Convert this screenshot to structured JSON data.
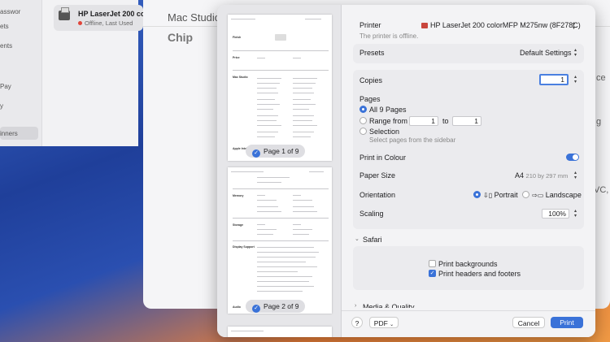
{
  "settings": {
    "sidebar_items": [
      "asswor",
      "ets",
      "ents",
      "Pay",
      "y",
      "inners"
    ],
    "selected_item": "inners",
    "printer_name": "HP LaserJet 200 color",
    "printer_status": "Offline, Last Used"
  },
  "background_window": {
    "title": "Mac Studio",
    "subtitle": "Chip",
    "right_edge_text": [
      "ce",
      "g",
      "VC,"
    ]
  },
  "preview": {
    "page1_badge": "Page 1 of 9",
    "page2_badge": "Page 2 of 9",
    "page1_labels": [
      "Finish",
      "Price",
      "Mac Studio",
      "Apple Intelligence"
    ],
    "page2_labels": [
      "Memory",
      "Storage",
      "Display Support",
      "Audio"
    ]
  },
  "dialog": {
    "printer_label": "Printer",
    "printer_value": "HP LaserJet 200 colorMFP M275nw (8F278C)",
    "printer_offline": "The printer is offline.",
    "presets_label": "Presets",
    "presets_value": "Default Settings",
    "copies_label": "Copies",
    "copies_value": "1",
    "pages_label": "Pages",
    "all_pages": "All 9 Pages",
    "range_from": "Range from",
    "range_start": "1",
    "range_to": "to",
    "range_end": "1",
    "selection": "Selection",
    "selection_hint": "Select pages from the sidebar",
    "colour_label": "Print in Colour",
    "paper_label": "Paper Size",
    "paper_value": "A4",
    "paper_dims": "210 by 297 mm",
    "orientation_label": "Orientation",
    "portrait": "Portrait",
    "landscape": "Landscape",
    "scaling_label": "Scaling",
    "scaling_value": "100%",
    "safari_section": "Safari",
    "print_backgrounds": "Print backgrounds",
    "print_headers": "Print headers and footers",
    "media_section": "Media & Quality",
    "help": "?",
    "pdf": "PDF",
    "cancel": "Cancel",
    "print": "Print"
  }
}
